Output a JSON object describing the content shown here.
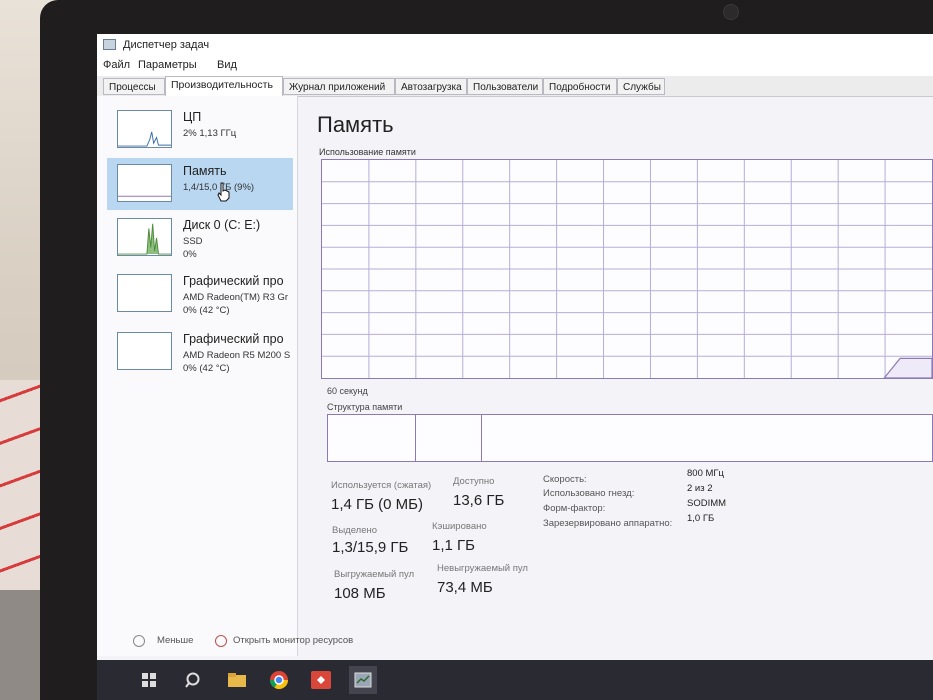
{
  "window": {
    "title": "Диспетчер задач"
  },
  "menu": [
    "Файл",
    "Параметры",
    "Вид"
  ],
  "tabs": [
    "Процессы",
    "Производительность",
    "Журнал приложений",
    "Автозагрузка",
    "Пользователи",
    "Подробности",
    "Службы"
  ],
  "sidebar": [
    {
      "name": "ЦП",
      "sub": "2% 1,13 ГГц",
      "sub2": ""
    },
    {
      "name": "Память",
      "sub": "1,4/15,0 ГБ (9%)",
      "sub2": ""
    },
    {
      "name": "Диск 0 (C: E:)",
      "sub": "SSD",
      "sub2": "0%"
    },
    {
      "name": "Графический про",
      "sub": "AMD Radeon(TM) R3 Gr",
      "sub2": "0% (42 °C)"
    },
    {
      "name": "Графический про",
      "sub": "AMD Radeon R5 M200 S",
      "sub2": "0% (42 °C)"
    }
  ],
  "memory": {
    "title": "Память",
    "usage_label": "Использование памяти",
    "time_label": "60 секунд",
    "structure_label": "Структура памяти",
    "usage_fraction": 0.09,
    "stats": [
      {
        "label": "Используется (сжатая)",
        "value": "1,4 ГБ (0 МБ)"
      },
      {
        "label": "Доступно",
        "value": "13,6 ГБ"
      },
      {
        "label": "Выделено",
        "value": "1,3/15,9 ГБ"
      },
      {
        "label": "Кэшировано",
        "value": "1,1 ГБ"
      },
      {
        "label": "Выгружаемый пул",
        "value": "108 МБ"
      },
      {
        "label": "Невыгружаемый пул",
        "value": "73,4 МБ"
      }
    ],
    "specs": [
      {
        "label": "Скорость:",
        "value": "800 МГц"
      },
      {
        "label": "Использовано гнезд:",
        "value": "2 из 2"
      },
      {
        "label": "Форм-фактор:",
        "value": "SODIMM"
      },
      {
        "label": "Зарезервировано аппаратно:",
        "value": "1,0 ГБ"
      }
    ]
  },
  "footer": {
    "less": "Меньше",
    "monitor": "Открыть монитор ресурсов"
  },
  "colors": {
    "accent": "#8b7ab5",
    "selected": "#b9d7f0",
    "disk_graph": "#4c8c3a",
    "cpu_graph": "#3b6fa8"
  }
}
